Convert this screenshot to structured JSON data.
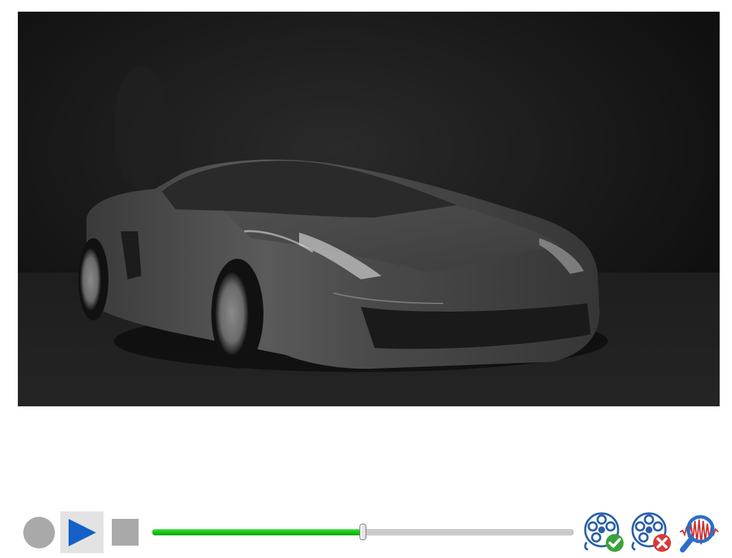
{
  "player": {
    "video": {
      "subject": "toy-sports-car-grayscale-frame"
    },
    "controls": {
      "record_icon": "record-icon",
      "play_icon": "play-icon",
      "stop_icon": "stop-icon",
      "accept_icon": "film-reel-check-icon",
      "reject_icon": "film-reel-x-icon",
      "analyze_icon": "waveform-magnifier-icon"
    },
    "seek": {
      "progress": 0.5
    },
    "colors": {
      "progress_fill": "#17c417",
      "play_accent": "#1560c7",
      "accept": "#3aa43a",
      "reject": "#d93a3a",
      "waveform": "#c93030",
      "reel": "#2b5fa8"
    }
  }
}
